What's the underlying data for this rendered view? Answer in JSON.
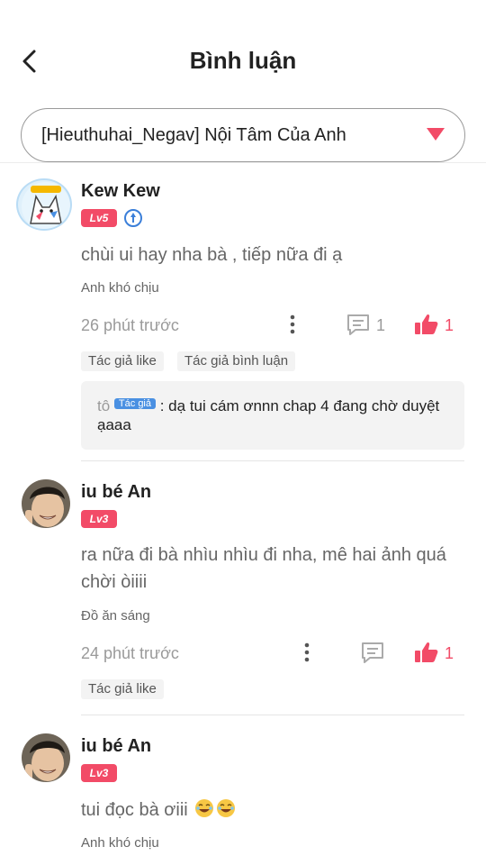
{
  "header": {
    "title": "Bình luận"
  },
  "chapter_selector": {
    "value": "[Hieuthuhai_Negav] Nội Tâm Của Anh"
  },
  "comments": [
    {
      "name": "Kew Kew",
      "level": "Lv5",
      "text": "chùi ui hay nha bà , tiếp nữa đi ạ",
      "sub": "Anh khó chịu",
      "time": "26 phút trước",
      "reply_count": "1",
      "like_count": "1",
      "tags": [
        "Tác giả like",
        "Tác giả bình luận"
      ],
      "author_reply": {
        "prefix": "tô",
        "chip": "Tác giả",
        "text": ": dạ tui cám ơnnn chap 4 đang chờ duyệt ạaaa"
      }
    },
    {
      "name": "iu bé An",
      "level": "Lv3",
      "text": "ra nữa đi bà nhìu nhìu đi nha, mê hai ảnh quá chời òiiii",
      "sub": "Đồ ăn sáng",
      "time": "24 phút trước",
      "like_count": "1",
      "tags": [
        "Tác giả like"
      ]
    },
    {
      "name": "iu bé An",
      "level": "Lv3",
      "text": "tui đọc bà ơiii",
      "sub": "Anh khó chịu"
    }
  ],
  "colors": {
    "accent": "#f24b67",
    "muted": "#9a9a9a",
    "chip": "#4a90e2"
  }
}
